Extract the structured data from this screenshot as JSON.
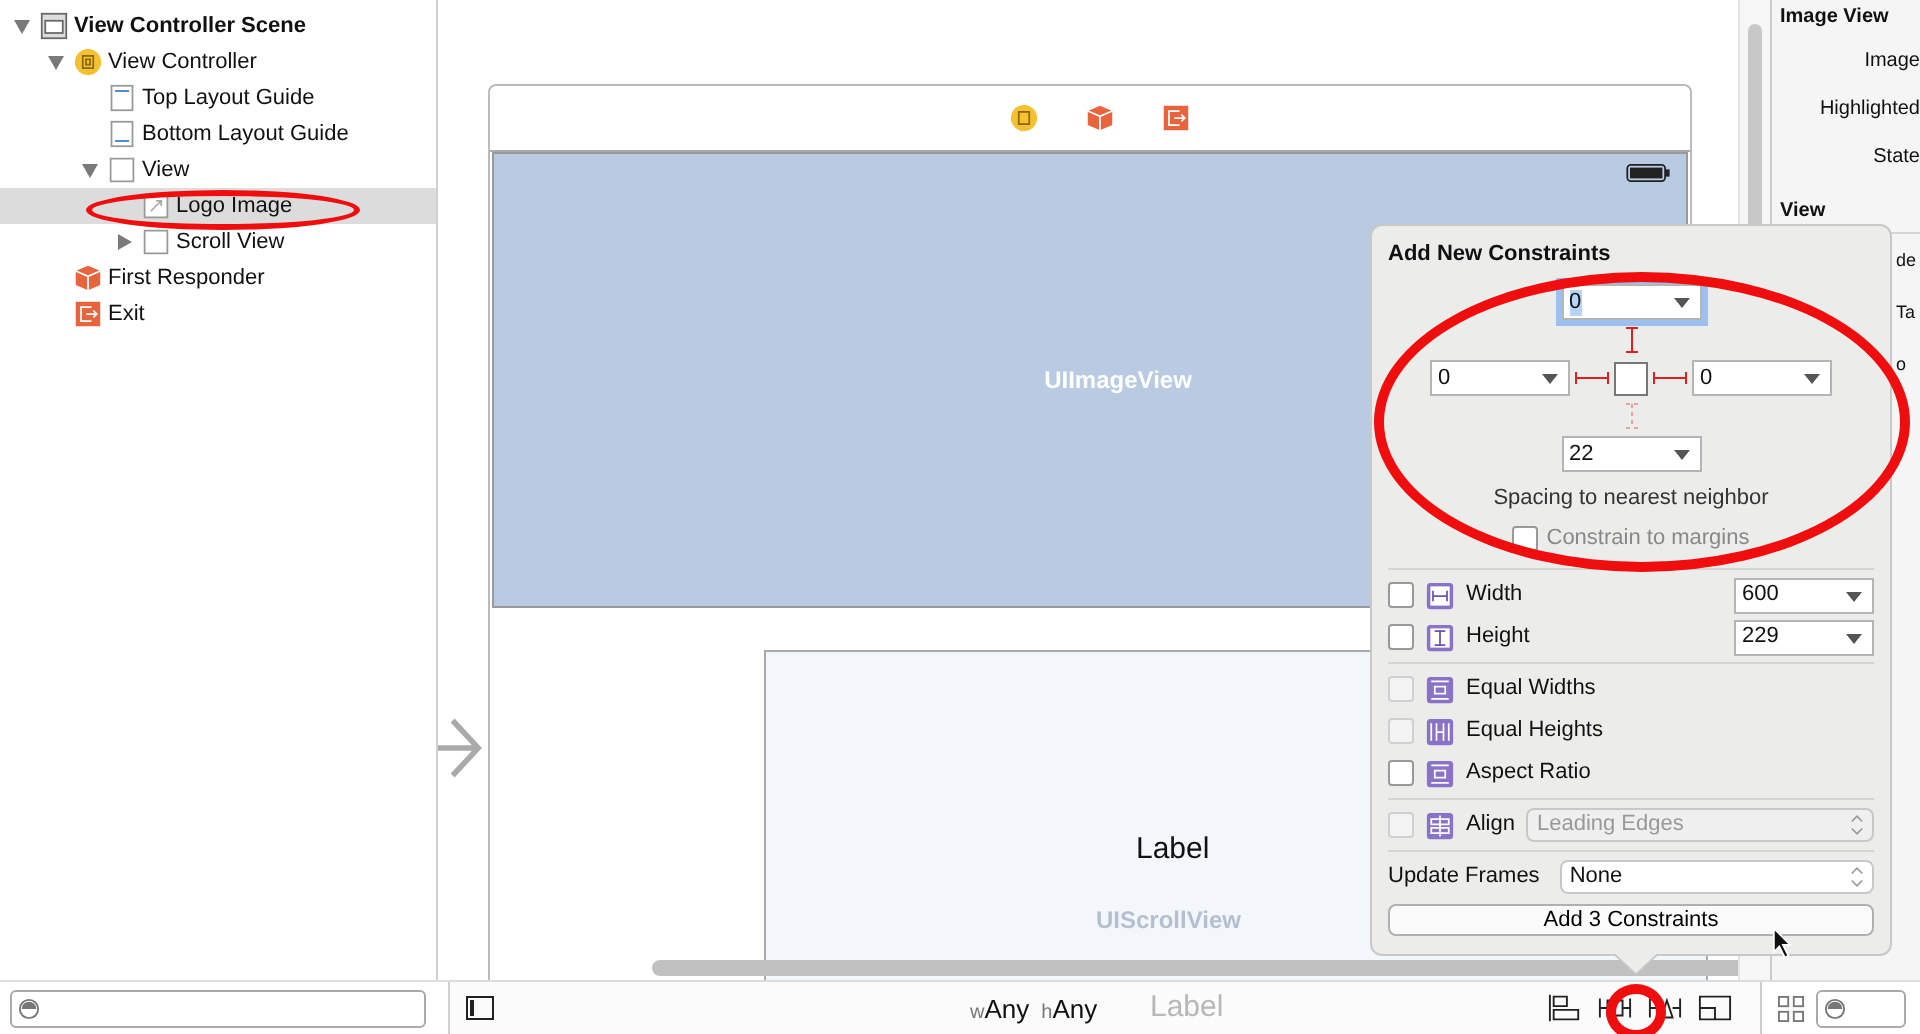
{
  "navigator": {
    "tree": [
      {
        "label": "View Controller Scene",
        "kind": "scene",
        "expanded": true,
        "selected": false,
        "children": [
          {
            "label": "View Controller",
            "kind": "controller",
            "expanded": true,
            "selected": false,
            "children": [
              {
                "label": "Top Layout Guide",
                "kind": "guide-top",
                "selected": false
              },
              {
                "label": "Bottom Layout Guide",
                "kind": "guide-bottom",
                "selected": false
              },
              {
                "label": "View",
                "kind": "view",
                "expanded": true,
                "selected": false,
                "children": [
                  {
                    "label": "Logo Image",
                    "kind": "image",
                    "selected": true
                  },
                  {
                    "label": "Scroll View",
                    "kind": "view",
                    "expanded": false,
                    "selected": false
                  }
                ]
              }
            ]
          },
          {
            "label": "First Responder",
            "kind": "responder",
            "selected": false
          },
          {
            "label": "Exit",
            "kind": "exit",
            "selected": false
          }
        ]
      }
    ]
  },
  "canvas": {
    "image_view_label": "UIImageView",
    "label_text": "Label",
    "scroll_view_label": "UIScrollView",
    "lower_label_text": "Label"
  },
  "size_class": {
    "width_prefix": "w",
    "width_value": "Any",
    "height_prefix": "h",
    "height_value": "Any"
  },
  "popover": {
    "title": "Add New Constraints",
    "spacing": {
      "top": {
        "value": "0",
        "focused": true,
        "active": true
      },
      "left": {
        "value": "0",
        "focused": false,
        "active": true
      },
      "right": {
        "value": "0",
        "focused": false,
        "active": true
      },
      "bottom": {
        "value": "22",
        "focused": false,
        "active": false
      }
    },
    "spacing_caption": "Spacing to nearest neighbor",
    "constrain_to_margins": {
      "label": "Constrain to margins",
      "checked": false
    },
    "size_rows": [
      {
        "label": "Width",
        "kind": "width",
        "value": "600",
        "checked": false
      },
      {
        "label": "Height",
        "kind": "height",
        "value": "229",
        "checked": false
      }
    ],
    "equal_rows": [
      {
        "label": "Equal Widths",
        "kind": "equal-widths",
        "checked": false,
        "disabled": true
      },
      {
        "label": "Equal Heights",
        "kind": "equal-heights",
        "checked": false,
        "disabled": true
      },
      {
        "label": "Aspect Ratio",
        "kind": "aspect",
        "checked": false,
        "disabled": false
      }
    ],
    "align": {
      "label": "Align",
      "value": "Leading Edges",
      "checked": false,
      "disabled": true
    },
    "update_frames": {
      "label": "Update Frames",
      "value": "None"
    },
    "add_button": "Add 3 Constraints"
  },
  "inspector": {
    "title": "Image View",
    "rows": [
      "Image",
      "Highlighted",
      "State"
    ],
    "section": "View",
    "section_rows": [
      "de",
      "Ta",
      "o"
    ]
  }
}
